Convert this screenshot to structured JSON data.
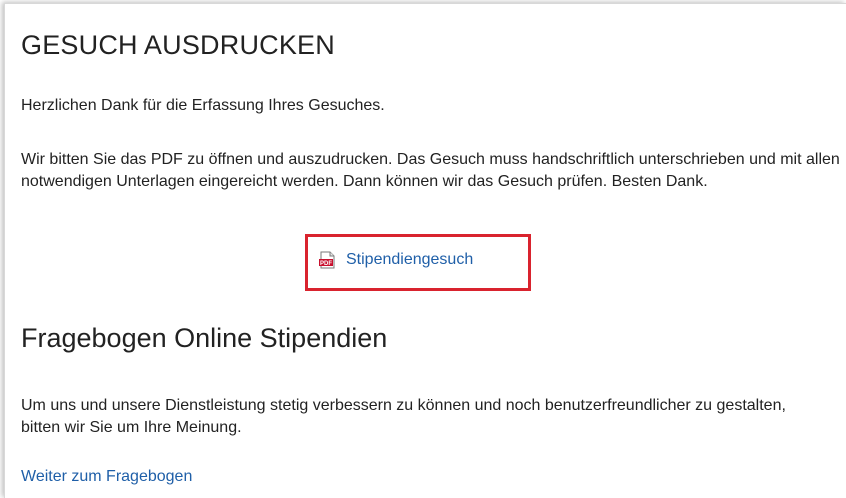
{
  "section1": {
    "title": "GESUCH AUSDRUCKEN",
    "thanks": "Herzlichen Dank für die Erfassung Ihres Gesuches.",
    "instructions": "Wir bitten Sie das PDF zu öffnen und auszudrucken. Das Gesuch muss handschriftlich unterschrieben und mit allen notwendigen Unterlagen eingereicht werden. Dann können wir das Gesuch prüfen. Besten Dank.",
    "pdf_link": {
      "label": "Stipendiengesuch",
      "icon": "pdf-file-icon",
      "highlight_color": "#d9232e"
    }
  },
  "section2": {
    "title": "Fragebogen Online Stipendien",
    "text": "Um uns und unsere Dienstleistung stetig verbessern zu können und noch benutzerfreundlicher zu gestalten, bitten wir Sie um Ihre Meinung.",
    "link_label": "Weiter zum Fragebogen"
  },
  "colors": {
    "link": "#1f5fa8",
    "highlight": "#d9232e",
    "text": "#222222"
  }
}
